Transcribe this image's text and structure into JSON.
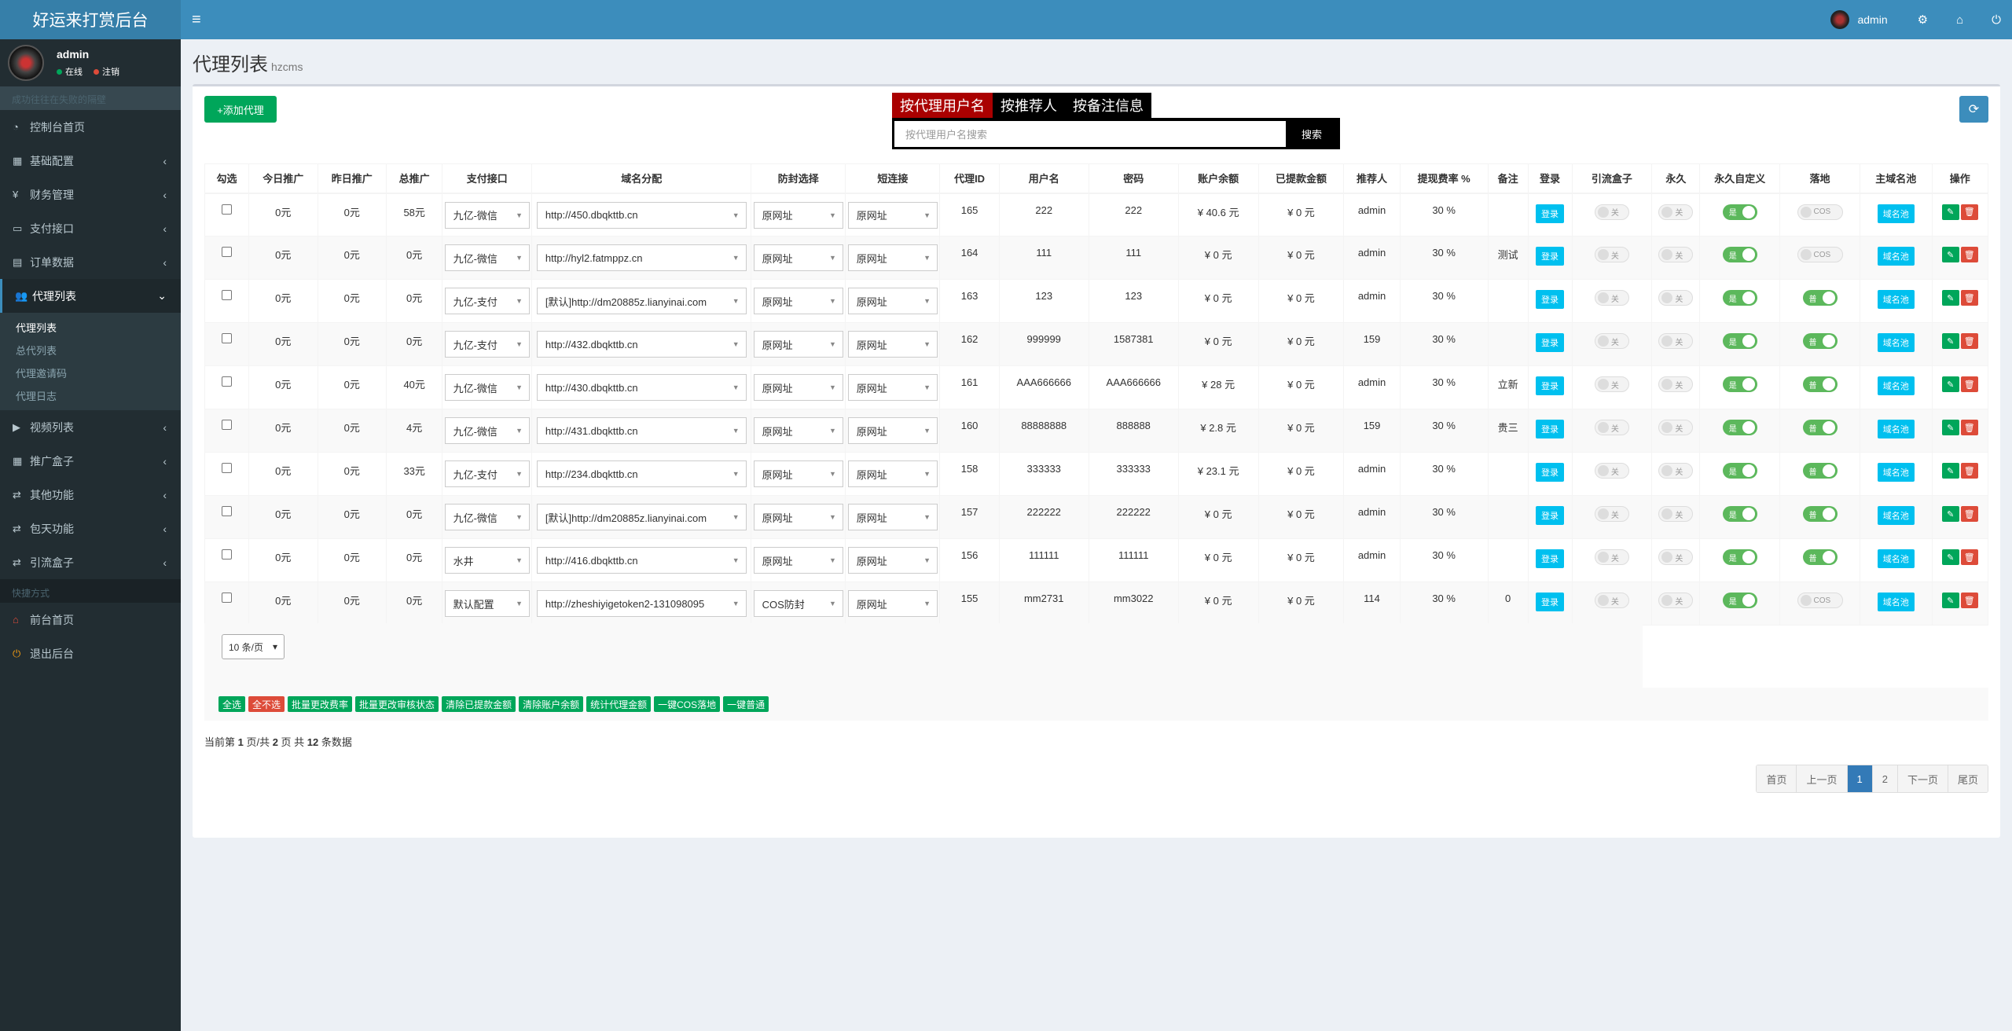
{
  "app": {
    "title": "好运来打赏后台",
    "user": "admin"
  },
  "sidebar": {
    "user": {
      "name": "admin",
      "online": "在线",
      "logout": "注销"
    },
    "search_hint": "成功往往在失败的隔壁",
    "items": [
      {
        "label": "控制台首页",
        "icon": "dashboard-icon"
      },
      {
        "label": "基础配置",
        "icon": "grid-icon"
      },
      {
        "label": "财务管理",
        "icon": "yen-icon"
      },
      {
        "label": "支付接口",
        "icon": "card-icon"
      },
      {
        "label": "订单数据",
        "icon": "chart-icon"
      },
      {
        "label": "代理列表",
        "icon": "users-icon"
      },
      {
        "label": "视频列表",
        "icon": "video-icon"
      },
      {
        "label": "推广盒子",
        "icon": "table-icon"
      },
      {
        "label": "其他功能",
        "icon": "retweet-icon"
      },
      {
        "label": "包天功能",
        "icon": "retweet-icon"
      },
      {
        "label": "引流盒子",
        "icon": "retweet-icon"
      }
    ],
    "sub": [
      "代理列表",
      "总代列表",
      "代理邀请码",
      "代理日志"
    ],
    "header2": "快捷方式",
    "quick": [
      {
        "label": "前台首页",
        "icon": "home-icon"
      },
      {
        "label": "退出后台",
        "icon": "power-icon"
      }
    ]
  },
  "page": {
    "title": "代理列表",
    "subtitle": "hzcms"
  },
  "toolbar": {
    "add": "+添加代理",
    "refresh_icon": "refresh-icon"
  },
  "search": {
    "tabs": [
      "按代理用户名",
      "按推荐人",
      "按备注信息"
    ],
    "placeholder": "按代理用户名搜索",
    "button": "搜索"
  },
  "table": {
    "headers": [
      "勾选",
      "今日推广",
      "昨日推广",
      "总推广",
      "支付接口",
      "域名分配",
      "防封选择",
      "短连接",
      "代理ID",
      "用户名",
      "密码",
      "账户余额",
      "已提款金额",
      "推荐人",
      "提现费率 %",
      "备注",
      "登录",
      "引流盒子",
      "永久",
      "永久自定义",
      "落地",
      "主域名池",
      "操作"
    ],
    "rows": [
      {
        "today": "0元",
        "yest": "0元",
        "total": "58元",
        "pay": "九亿-微信",
        "domain": "http://450.dbqkttb.cn",
        "guard": "原网址",
        "short": "原网址",
        "id": "165",
        "user": "222",
        "pwd": "222",
        "bal": "¥ 40.6 元",
        "wd": "¥ 0 元",
        "ref": "admin",
        "rate": "30 %",
        "note": "",
        "land": "COS"
      },
      {
        "today": "0元",
        "yest": "0元",
        "total": "0元",
        "pay": "九亿-微信",
        "domain": "http://hyl2.fatmppz.cn",
        "guard": "原网址",
        "short": "原网址",
        "id": "164",
        "user": "111",
        "pwd": "111",
        "bal": "¥ 0 元",
        "wd": "¥ 0 元",
        "ref": "admin",
        "rate": "30 %",
        "note": "测试",
        "land": "COS"
      },
      {
        "today": "0元",
        "yest": "0元",
        "total": "0元",
        "pay": "九亿-支付",
        "domain": "[默认]http://dm20885z.lianyinai.com",
        "guard": "原网址",
        "short": "原网址",
        "id": "163",
        "user": "123",
        "pwd": "123",
        "bal": "¥ 0 元",
        "wd": "¥ 0 元",
        "ref": "admin",
        "rate": "30 %",
        "note": "",
        "land": "普"
      },
      {
        "today": "0元",
        "yest": "0元",
        "total": "0元",
        "pay": "九亿-支付",
        "domain": "http://432.dbqkttb.cn",
        "guard": "原网址",
        "short": "原网址",
        "id": "162",
        "user": "999999",
        "pwd": "1587381",
        "bal": "¥ 0 元",
        "wd": "¥ 0 元",
        "ref": "159",
        "rate": "30 %",
        "note": "",
        "land": "普"
      },
      {
        "today": "0元",
        "yest": "0元",
        "total": "40元",
        "pay": "九亿-微信",
        "domain": "http://430.dbqkttb.cn",
        "guard": "原网址",
        "short": "原网址",
        "id": "161",
        "user": "AAA666666",
        "pwd": "AAA666666",
        "bal": "¥ 28 元",
        "wd": "¥ 0 元",
        "ref": "admin",
        "rate": "30 %",
        "note": "立新",
        "land": "普"
      },
      {
        "today": "0元",
        "yest": "0元",
        "total": "4元",
        "pay": "九亿-微信",
        "domain": "http://431.dbqkttb.cn",
        "guard": "原网址",
        "short": "原网址",
        "id": "160",
        "user": "88888888",
        "pwd": "888888",
        "bal": "¥ 2.8 元",
        "wd": "¥ 0 元",
        "ref": "159",
        "rate": "30 %",
        "note": "贵三",
        "land": "普"
      },
      {
        "today": "0元",
        "yest": "0元",
        "total": "33元",
        "pay": "九亿-支付",
        "domain": "http://234.dbqkttb.cn",
        "guard": "原网址",
        "short": "原网址",
        "id": "158",
        "user": "333333",
        "pwd": "333333",
        "bal": "¥ 23.1 元",
        "wd": "¥ 0 元",
        "ref": "admin",
        "rate": "30 %",
        "note": "",
        "land": "普"
      },
      {
        "today": "0元",
        "yest": "0元",
        "total": "0元",
        "pay": "九亿-微信",
        "domain": "[默认]http://dm20885z.lianyinai.com",
        "guard": "原网址",
        "short": "原网址",
        "id": "157",
        "user": "222222",
        "pwd": "222222",
        "bal": "¥ 0 元",
        "wd": "¥ 0 元",
        "ref": "admin",
        "rate": "30 %",
        "note": "",
        "land": "普"
      },
      {
        "today": "0元",
        "yest": "0元",
        "total": "0元",
        "pay": "水井",
        "domain": "http://416.dbqkttb.cn",
        "guard": "原网址",
        "short": "原网址",
        "id": "156",
        "user": "111111",
        "pwd": "111111",
        "bal": "¥ 0 元",
        "wd": "¥ 0 元",
        "ref": "admin",
        "rate": "30 %",
        "note": "",
        "land": "普"
      },
      {
        "today": "0元",
        "yest": "0元",
        "total": "0元",
        "pay": "默认配置",
        "domain": "http://zheshiyigetoken2-131098095",
        "guard": "COS防封",
        "short": "原网址",
        "id": "155",
        "user": "mm2731",
        "pwd": "mm3022",
        "bal": "¥ 0 元",
        "wd": "¥ 0 元",
        "ref": "114",
        "rate": "30 %",
        "note": "0",
        "land": "COS"
      }
    ],
    "login_label": "登录",
    "off_label": "关",
    "on_label": "是",
    "pool_label": "域名池"
  },
  "page_size": "10 条/页",
  "bulk": [
    {
      "label": "全选",
      "color": "#00a65a"
    },
    {
      "label": "全不选",
      "color": "#dd4b39"
    },
    {
      "label": "批量更改费率",
      "color": "#00a65a"
    },
    {
      "label": "批量更改审核状态",
      "color": "#00a65a"
    },
    {
      "label": "清除已提款金额",
      "color": "#00a65a"
    },
    {
      "label": "清除账户余额",
      "color": "#00a65a"
    },
    {
      "label": "统计代理金额",
      "color": "#00a65a"
    },
    {
      "label": "一键COS落地",
      "color": "#00a65a"
    },
    {
      "label": "一键普通",
      "color": "#00a65a"
    }
  ],
  "summary": {
    "p1": "当前第 ",
    "cur": "1",
    "p2": " 页/共 ",
    "pages": "2",
    "p3": " 页 共 ",
    "total": "12",
    "p4": " 条数据"
  },
  "pager": [
    "首页",
    "上一页",
    "1",
    "2",
    "下一页",
    "尾页"
  ],
  "colors": {
    "header": "#3c8dbc",
    "sidebar": "#222d32",
    "success": "#00a65a",
    "danger": "#dd4b39",
    "info": "#00c0ef"
  }
}
